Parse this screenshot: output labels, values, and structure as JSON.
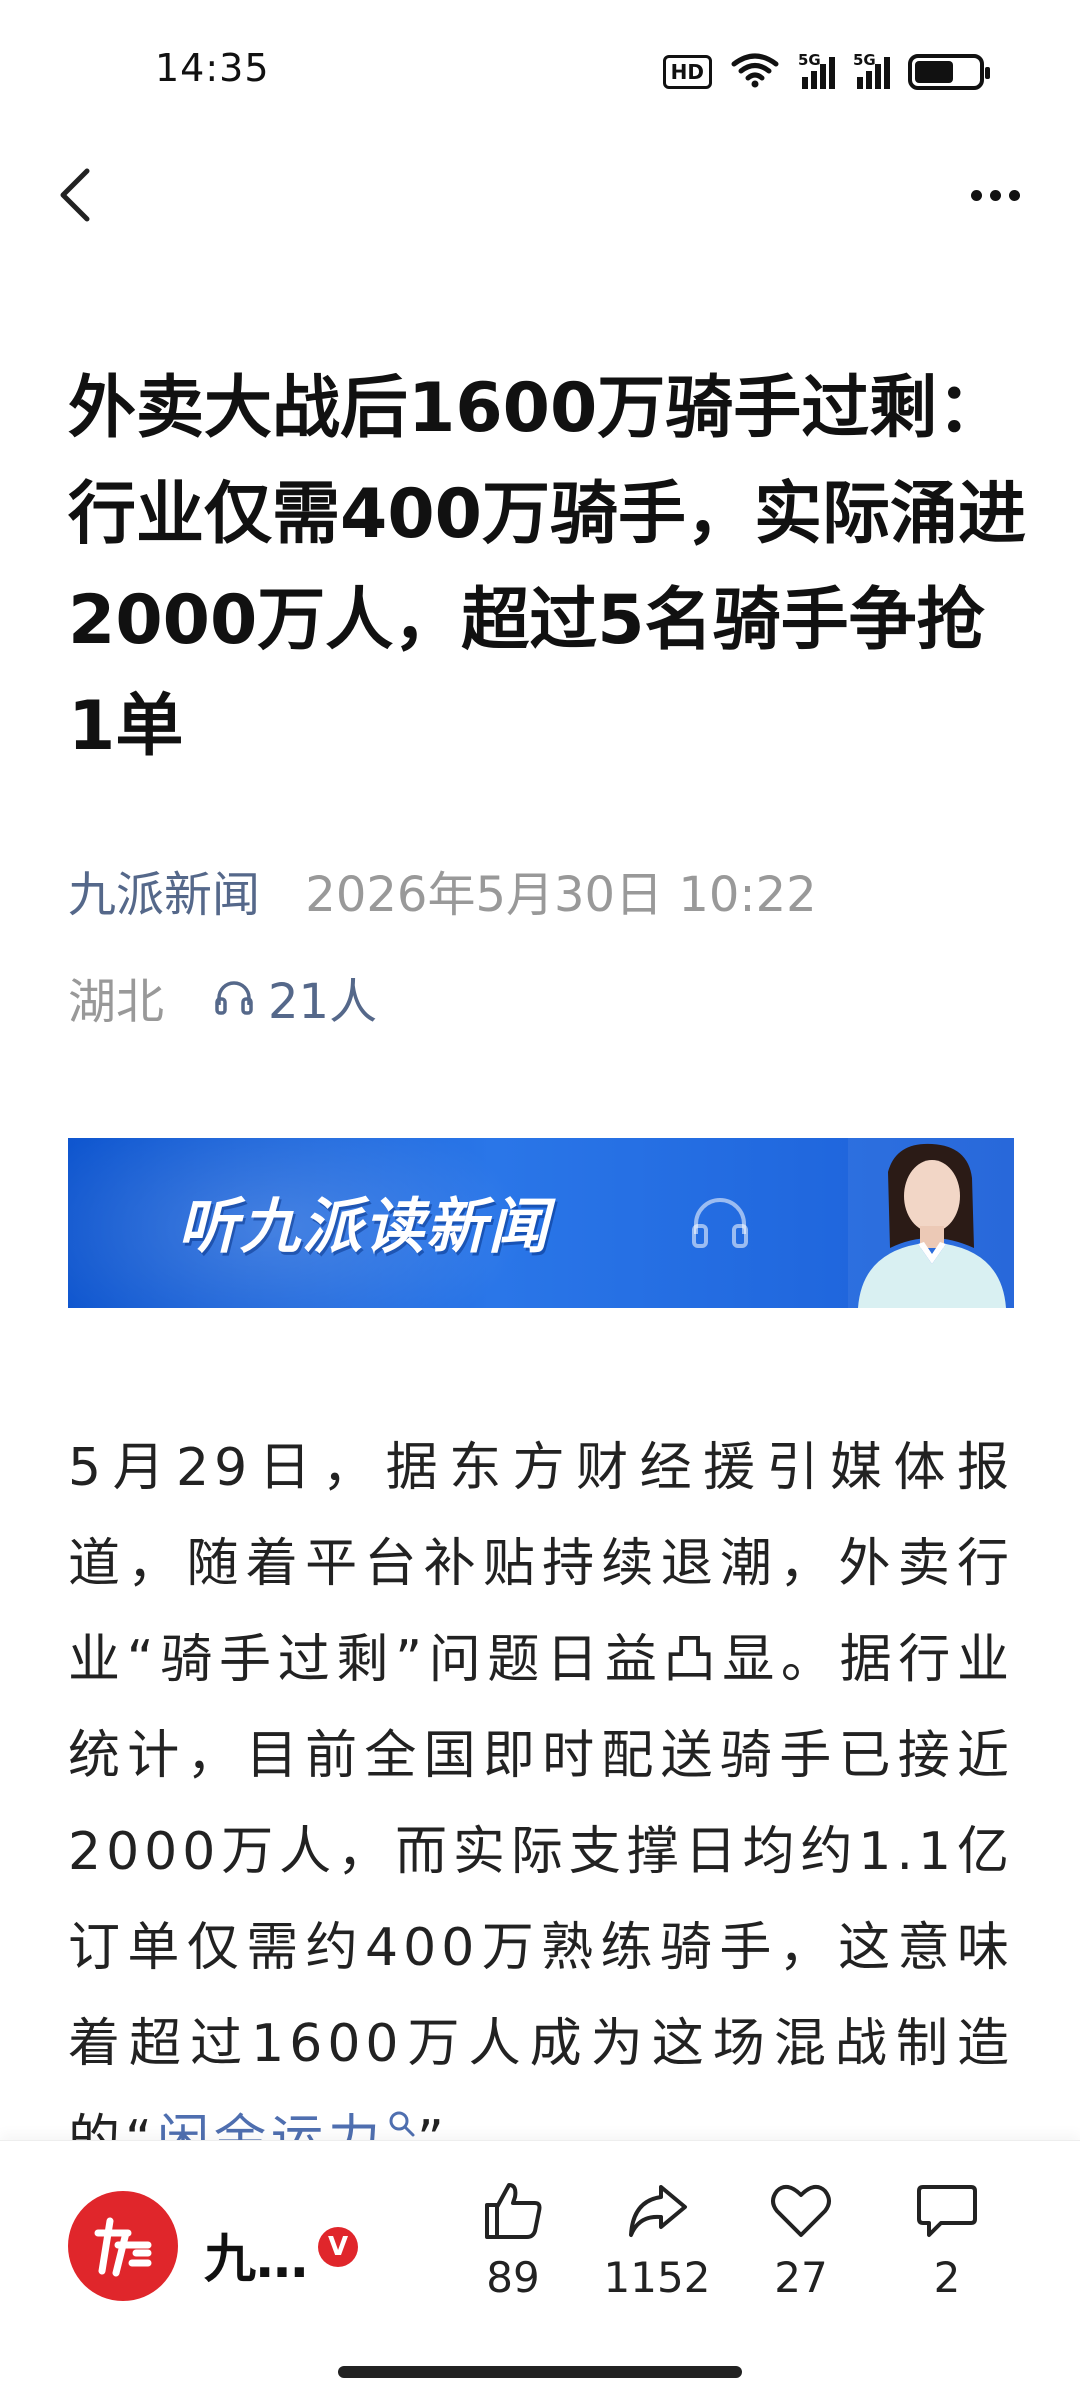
{
  "status_bar": {
    "time": "14:35",
    "hd_label": "HD",
    "signal1_label": "5G",
    "signal2_label": "5G",
    "battery_level": 0.62
  },
  "nav": {
    "back_icon": "chevron-left-icon",
    "more_icon": "more-dots-icon"
  },
  "article": {
    "title": "外卖大战后1600万骑手过剩：行业仅需400万骑手，实际涌进2000万人，超过5名骑手争抢1单",
    "source": "九派新闻",
    "datetime": "2026年5月30日 10:22",
    "location": "湖北",
    "listeners": "21人",
    "banner_text": "听九派读新闻",
    "body_before_link": "5月29日，据东方财经援引媒体报道，随着平台补贴持续退潮，外卖行业“骑手过剩”问题日益凸显。据行业统计，目前全国即时配送骑手已接近2000万人，而实际支撑日均约1.1亿订单仅需约400万熟练骑手，这意味着超过1600万人成为这场混战制造的“",
    "body_link": "闲余运力",
    "body_after_link": "”"
  },
  "bottom_bar": {
    "author": "九…",
    "verified_label": "V",
    "like_count": "89",
    "share_count": "1152",
    "favorite_count": "27",
    "comment_count": "2"
  },
  "colors": {
    "brand_red": "#e0262b",
    "source_blue": "#55688a",
    "banner_blue": "#1b5fd8"
  }
}
